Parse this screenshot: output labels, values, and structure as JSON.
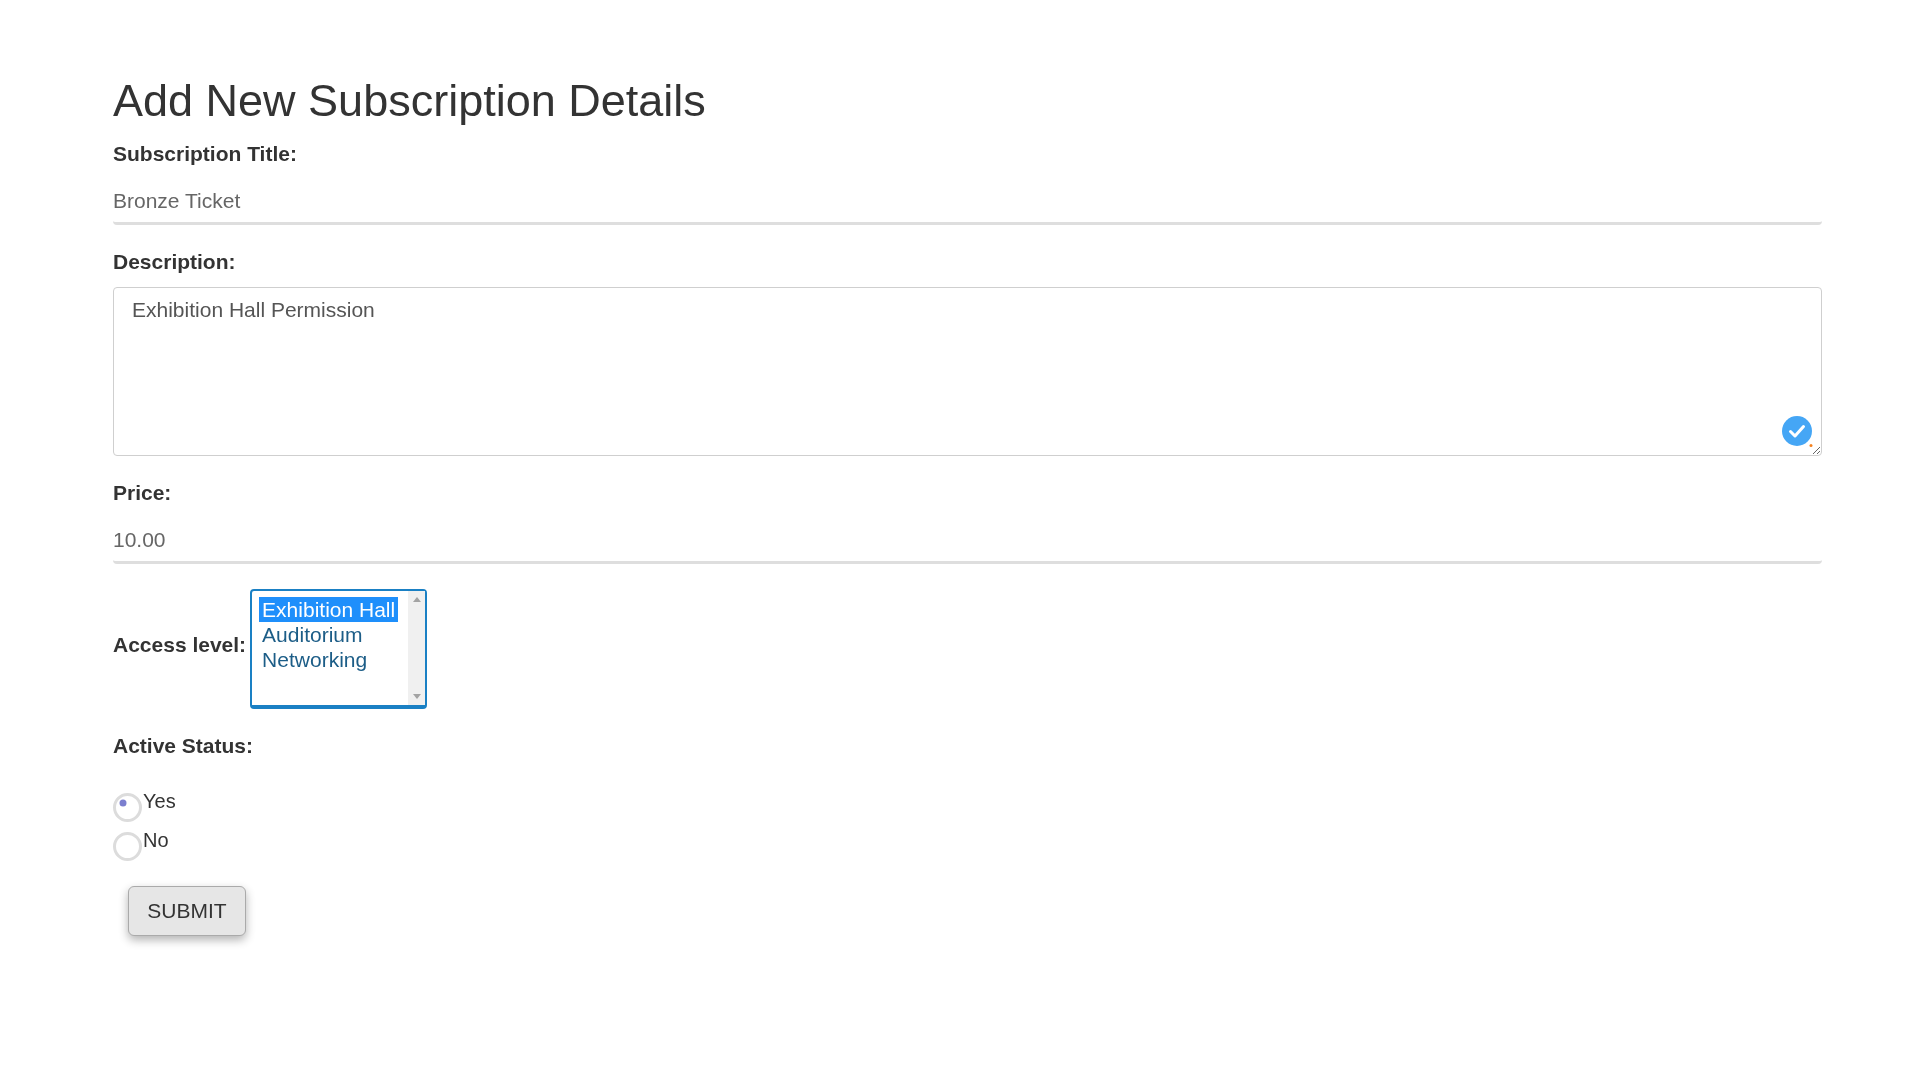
{
  "heading": "Add New Subscription Details",
  "fields": [
    {
      "kind": "text",
      "label": "Subscription Title:",
      "value": "Bronze Ticket"
    },
    {
      "kind": "textarea",
      "label": "Description:",
      "value": "Exhibition Hall Permission"
    },
    {
      "kind": "text",
      "label": "Price:",
      "value": "10.00"
    },
    {
      "kind": "listbox",
      "label": "Access level:",
      "options": [
        {
          "label": "Exhibition Hall",
          "selected": true
        },
        {
          "label": "Auditorium",
          "selected": false
        },
        {
          "label": "Networking",
          "selected": false
        }
      ]
    },
    {
      "kind": "radio",
      "label": "Active Status:",
      "options": [
        {
          "label": "Yes",
          "selected": true
        },
        {
          "label": "No",
          "selected": false
        }
      ]
    }
  ],
  "submit_button": {
    "label": "SUBMIT"
  }
}
